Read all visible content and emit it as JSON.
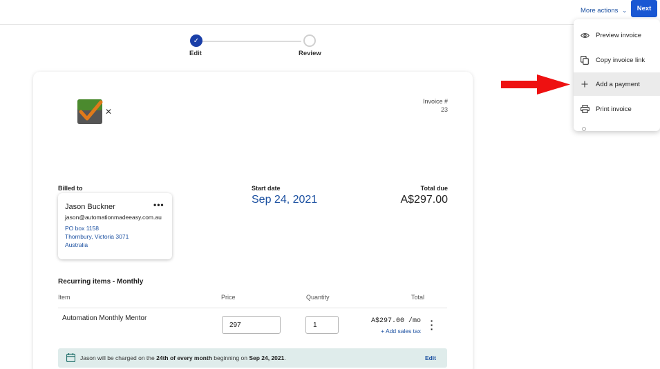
{
  "topbar": {
    "more_actions_label": "More actions",
    "next_label": "Next"
  },
  "stepper": {
    "steps": [
      {
        "label": "Edit",
        "state": "complete"
      },
      {
        "label": "Review",
        "state": "pending"
      }
    ]
  },
  "invoice": {
    "number_label": "Invoice #",
    "number": "23",
    "billed_to_label": "Billed to",
    "client": {
      "name": "Jason Buckner",
      "email": "jason@automationmadeeasy.com.au",
      "address_line1": "PO box 1158",
      "address_line2": "Thornbury, Victoria 3071",
      "address_line3": "Australia"
    },
    "start_date_label": "Start date",
    "start_date": "Sep 24, 2021",
    "total_due_label": "Total due",
    "total_due": "A$297.00"
  },
  "recurring": {
    "title": "Recurring items - Monthly",
    "columns": [
      "Item",
      "Price",
      "Quantity",
      "Total"
    ],
    "items": [
      {
        "name": "Automation Monthly Mentor",
        "price": "297",
        "quantity": "1",
        "total": "A$297.00 /mo",
        "add_tax_label": "+ Add sales tax"
      }
    ],
    "banner": {
      "prefix": "Jason will be charged on the ",
      "day": "24th of every month",
      "middle": " beginning on ",
      "date": "Sep 24, 2021",
      "suffix": ".",
      "edit_label": "Edit"
    }
  },
  "menu": {
    "items": [
      {
        "label": "Preview invoice",
        "icon": "eye-icon"
      },
      {
        "label": "Copy invoice link",
        "icon": "copy-icon"
      },
      {
        "label": "Add a payment",
        "icon": "plus-icon"
      },
      {
        "label": "Print invoice",
        "icon": "printer-icon"
      }
    ]
  },
  "colors": {
    "primary": "#1957d3",
    "step_complete": "#1a3fa8",
    "link": "#1a4fa0",
    "banner_bg": "#dfeceb",
    "annotation_arrow": "#ee1111",
    "hover_bg": "#ebebeb"
  }
}
